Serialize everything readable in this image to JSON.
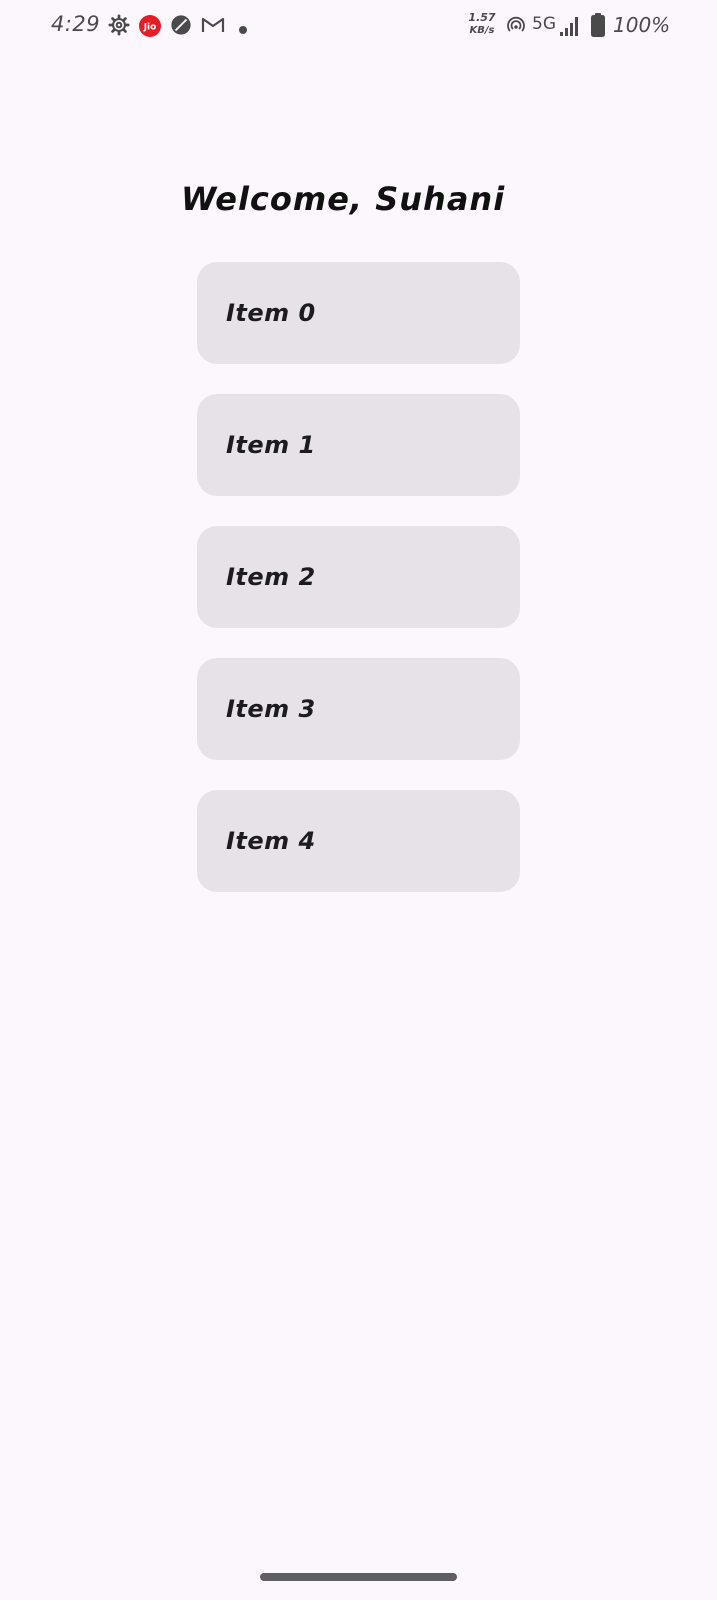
{
  "status_bar": {
    "time": "4:29",
    "jio_label": "Jio",
    "net_speed_value": "1.57",
    "net_speed_unit": "KB/s",
    "network_type": "5G",
    "battery_percent": "100%",
    "icons": [
      "settings-gear-icon",
      "jio-icon",
      "leaf-icon",
      "gmail-icon",
      "notification-dot-icon",
      "hotspot-icon",
      "signal-bars-icon",
      "battery-icon"
    ]
  },
  "main": {
    "welcome_text": "Welcome, Suhani",
    "items": [
      {
        "label": "Item 0"
      },
      {
        "label": "Item 1"
      },
      {
        "label": "Item 2"
      },
      {
        "label": "Item 3"
      },
      {
        "label": "Item 4"
      }
    ]
  },
  "colors": {
    "background": "#FCF7FC",
    "item_background": "#E7E2E8",
    "text": "#1C1B1F",
    "jio_red": "#E31E24"
  }
}
